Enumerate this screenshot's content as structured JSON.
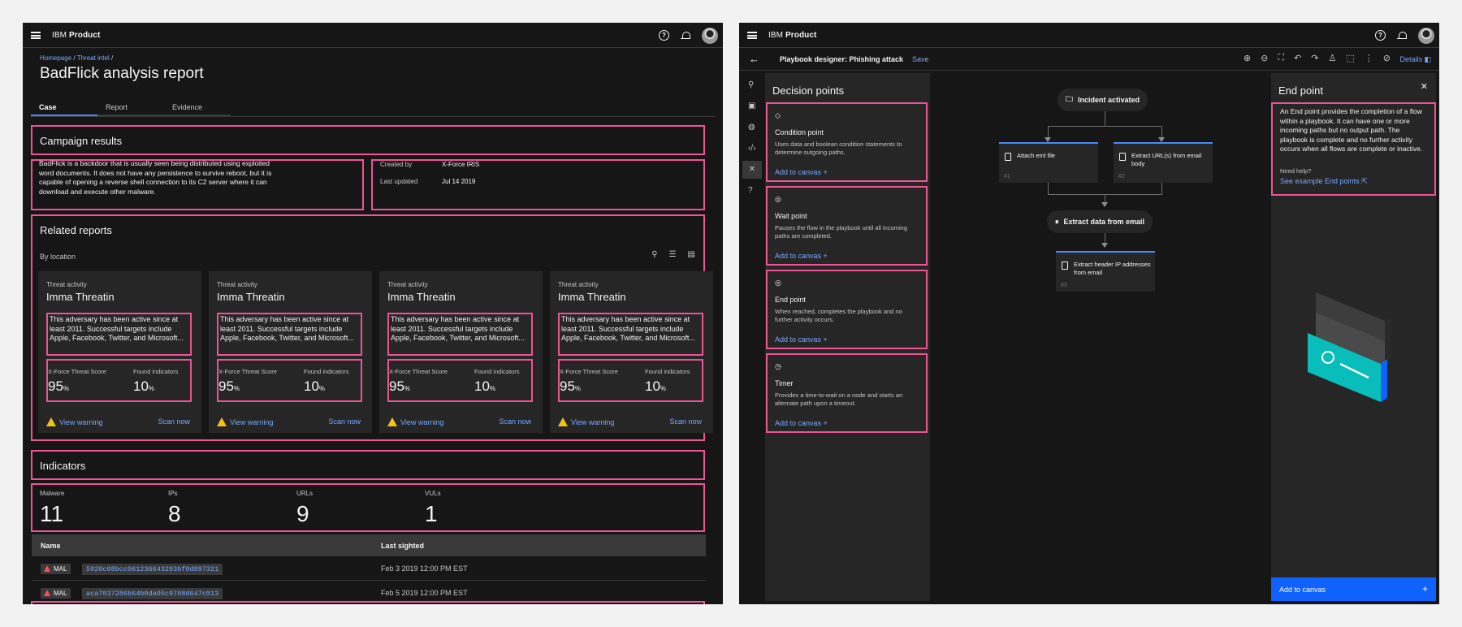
{
  "left": {
    "brand_prefix": "IBM",
    "brand_name": "Product",
    "breadcrumbs": [
      "Homepage",
      "Threat intel"
    ],
    "breadcrumb_sep": "/",
    "page_title": "BadFlick analysis report",
    "tabs": [
      "Case",
      "Report",
      "Evidence"
    ],
    "campaign": {
      "title": "Campaign results",
      "description": "BadFlick is a backdoor that is usually seen being distributed using exploited word documents. It does not have any persistence to survive reboot, but it is capable of opening a reverse shell connection to its C2 server where it can download and execute other malware.",
      "created_by_label": "Created by",
      "created_by_value": "X-Force IRIS",
      "updated_label": "Last updated",
      "updated_value": "Jul 14 2019"
    },
    "related": {
      "title": "Related reports",
      "filter_label": "By location",
      "cards": [
        {
          "category": "Threat activity",
          "title": "Imma Threatin",
          "desc": "This adversary has been active since at least 2011. Successful targets include Apple, Facebook, Twitter, and Microsoft...",
          "score_label": "X-Force Threat Score",
          "score": "95",
          "score_unit": "%",
          "ind_label": "Found indicators",
          "ind": "10",
          "ind_unit": "%",
          "warn": "View warning",
          "scan": "Scan now"
        },
        {
          "category": "Threat activity",
          "title": "Imma Threatin",
          "desc": "This adversary has been active since at least 2011. Successful targets include Apple, Facebook, Twitter, and Microsoft...",
          "score_label": "X-Force Threat Score",
          "score": "95",
          "score_unit": "%",
          "ind_label": "Found indicators",
          "ind": "10",
          "ind_unit": "%",
          "warn": "View warning",
          "scan": "Scan now"
        },
        {
          "category": "Threat activity",
          "title": "Imma Threatin",
          "desc": "This adversary has been active since at least 2011. Successful targets include Apple, Facebook, Twitter, and Microsoft...",
          "score_label": "X-Force Threat Score",
          "score": "95",
          "score_unit": "%",
          "ind_label": "Found indicators",
          "ind": "10",
          "ind_unit": "%",
          "warn": "View warning",
          "scan": "Scan now"
        },
        {
          "category": "Threat activity",
          "title": "Imma Threatin",
          "desc": "This adversary has been active since at least 2011. Successful targets include Apple, Facebook, Twitter, and Microsoft...",
          "score_label": "X-Force Threat Score",
          "score": "95",
          "score_unit": "%",
          "ind_label": "Found indicators",
          "ind": "10",
          "ind_unit": "%",
          "warn": "View warning",
          "scan": "Scan now"
        }
      ]
    },
    "indicators": {
      "title": "Indicators",
      "stats": [
        {
          "label": "Malware",
          "value": "11"
        },
        {
          "label": "IPs",
          "value": "8"
        },
        {
          "label": "URLs",
          "value": "9"
        },
        {
          "label": "VULs",
          "value": "1"
        }
      ]
    },
    "table": {
      "headers": [
        "Name",
        "Last sighted"
      ],
      "rows": [
        {
          "tag": "MAL",
          "hash": "5020c08bcc061236643293bf0d897321",
          "sighted": "Feb 3 2019 12:00 PM EST"
        },
        {
          "tag": "MAL",
          "hash": "aca7037286b64b0da05c9708d647c013",
          "sighted": "Feb 5 2019 12:00 PM EST"
        }
      ]
    }
  },
  "right": {
    "brand_prefix": "IBM",
    "brand_name": "Product",
    "designer_title": "Playbook designer: Phishing attack",
    "save_label": "Save",
    "details_label": "Details",
    "decision": {
      "title": "Decision points",
      "items": [
        {
          "icon": "◇",
          "name": "Condition point",
          "desc": "Uses data and boolean condition statements to determine outgoing paths.",
          "add": "Add to canvas  +"
        },
        {
          "icon": "◎",
          "name": "Wait point",
          "desc": "Pauses the flow in the playbook until all incoming paths are completed.",
          "add": "Add to canvas  +"
        },
        {
          "icon": "◎",
          "name": "End point",
          "desc": "When reached, completes the playbook and no further activity occurs.",
          "add": "Add to canvas  +"
        },
        {
          "icon": "◷",
          "name": "Timer",
          "desc": "Provides a time-to-wait on a node and starts an alternate path upon a timeout.",
          "add": "Add to canvas  +"
        }
      ]
    },
    "flow": {
      "start": "Incident activated",
      "task1": "Attach eml file",
      "task1_num": "#1",
      "task2": "Extract URL(s)  from email body",
      "task2_num": "#2",
      "merge": "Extract data from email",
      "task3": "Extract header IP addresses from email",
      "task3_num": "#3"
    },
    "endpoint": {
      "title": "End point",
      "desc": "An End point provides the completion of a flow within a playbook. It can have one or more incoming paths but no output path. The playbook is complete and no further activity occurs when all flows are complete or inactive.",
      "need_help": "Need help?",
      "link": "See example End points",
      "button": "Add to canvas",
      "button_icon": "+"
    }
  },
  "colors": {
    "accent": "#0f62fe",
    "link": "#78a9ff",
    "highlight": "#ee5396",
    "warning": "#f1c21b",
    "danger": "#fa4d56"
  }
}
